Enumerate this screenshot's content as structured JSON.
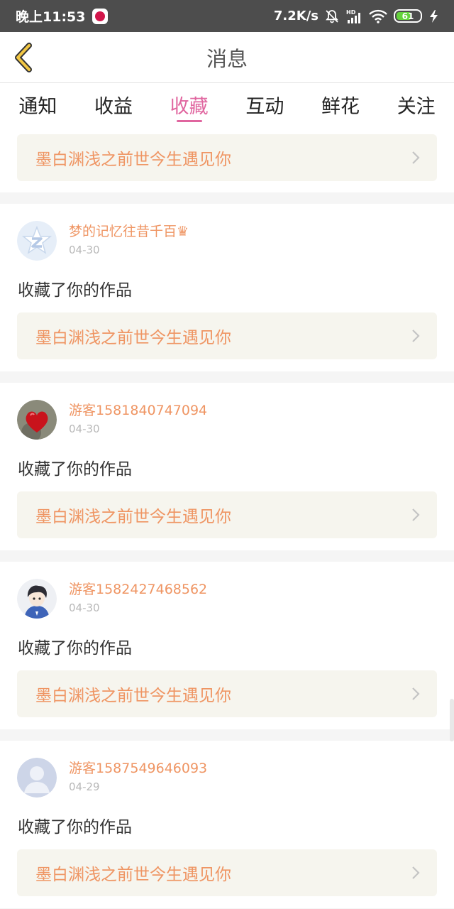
{
  "status_bar": {
    "time": "晚上11:53",
    "net_speed": "7.2K/s",
    "battery": "61"
  },
  "header": {
    "title": "消息"
  },
  "tabs": [
    {
      "label": "通知"
    },
    {
      "label": "收益"
    },
    {
      "label": "收藏"
    },
    {
      "label": "互动"
    },
    {
      "label": "鲜花"
    },
    {
      "label": "关注"
    }
  ],
  "active_tab": "收藏",
  "first_work": {
    "title": "墨白渊浅之前世今生遇见你"
  },
  "items": [
    {
      "username": "梦的记忆往昔千百♛",
      "date": "04-30",
      "action": "收藏了你的作品",
      "work": "墨白渊浅之前世今生遇见你"
    },
    {
      "username": "游客1581840747094",
      "date": "04-30",
      "action": "收藏了你的作品",
      "work": "墨白渊浅之前世今生遇见你"
    },
    {
      "username": "游客1582427468562",
      "date": "04-30",
      "action": "收藏了你的作品",
      "work": "墨白渊浅之前世今生遇见你"
    },
    {
      "username": "游客1587549646093",
      "date": "04-29",
      "action": "收藏了你的作品",
      "work": "墨白渊浅之前世今生遇见你"
    }
  ],
  "colors": {
    "accent": "#e0659f",
    "username": "#ef9563",
    "card_bg": "#f6f5ee",
    "status_bar": "#4d4d4d"
  }
}
